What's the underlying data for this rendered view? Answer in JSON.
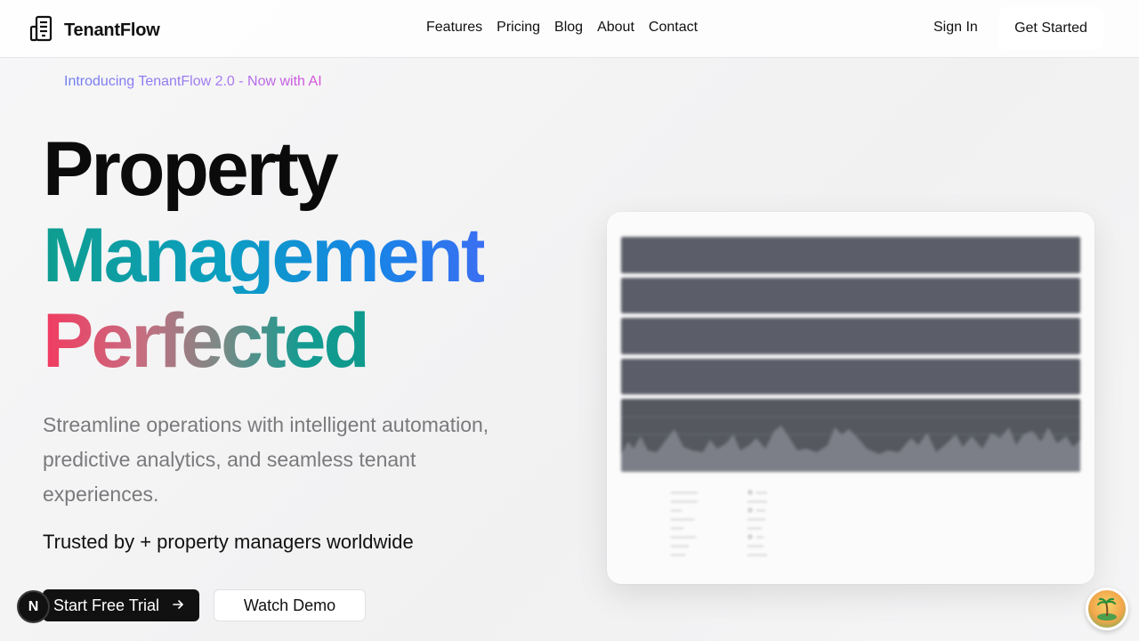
{
  "nav": {
    "brand": "TenantFlow",
    "links": [
      "Features",
      "Pricing",
      "Blog",
      "About",
      "Contact"
    ],
    "sign_in": "Sign In",
    "get_started": "Get Started"
  },
  "hero": {
    "announcement": "Introducing TenantFlow 2.0 - Now with AI",
    "title_line1": "Property",
    "title_line2": "Management",
    "title_line3": "Perfected",
    "subtitle": "Streamline operations with intelligent automation, predictive analytics, and seamless tenant experiences.",
    "trusted": "Trusted by + property managers worldwide",
    "primary_cta": "Start Free Trial",
    "secondary_cta": "Watch Demo"
  },
  "dev_badge": "N",
  "colors": {
    "accent_teal": "#0f9d8e",
    "accent_blue": "#3b6ff2",
    "accent_pink": "#f23a60",
    "dark": "#111111"
  },
  "icons": {
    "brand": "building-icon",
    "cta_arrow": "arrow-right-icon",
    "avatar": "island-avatar-icon"
  }
}
